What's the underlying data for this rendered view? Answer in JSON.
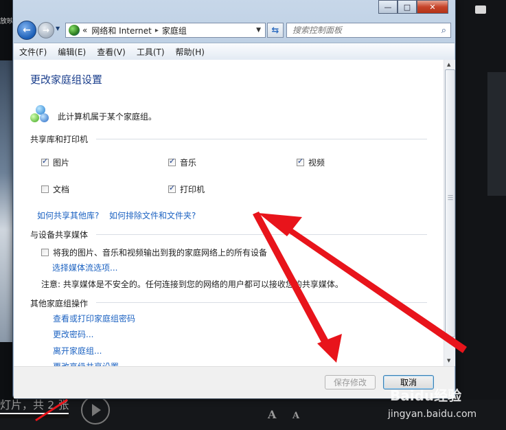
{
  "window": {
    "caption_buttons": {
      "minimize": "—",
      "maximize": "□",
      "close": "✕"
    }
  },
  "navigation": {
    "back_glyph": "←",
    "forward_glyph": "→",
    "address_prefix": "«",
    "breadcrumb": [
      "网络和 Internet",
      "家庭组"
    ],
    "separator": "▸",
    "refresh_glyph": "⇆",
    "search_placeholder": "搜索控制面板"
  },
  "menu": [
    "文件(F)",
    "编辑(E)",
    "查看(V)",
    "工具(T)",
    "帮助(H)"
  ],
  "content": {
    "title": "更改家庭组设置",
    "homegroup_status": "此计算机属于某个家庭组。",
    "libraries": {
      "heading": "共享库和打印机",
      "items": [
        {
          "label": "图片",
          "checked": true
        },
        {
          "label": "音乐",
          "checked": true
        },
        {
          "label": "视频",
          "checked": true
        },
        {
          "label": "文档",
          "checked": false
        },
        {
          "label": "打印机",
          "checked": true
        }
      ],
      "link_share_other": "如何共享其他库?",
      "link_exclude": "如何排除文件和文件夹?"
    },
    "media": {
      "heading": "与设备共享媒体",
      "stream_checkbox": {
        "label": "将我的图片、音乐和视频输出到我的家庭网络上的所有设备",
        "checked": false
      },
      "stream_options_link": "选择媒体流选项...",
      "note": "注意: 共享媒体是不安全的。任何连接到您的网络的用户都可以接收您的共享媒体。"
    },
    "other": {
      "heading": "其他家庭组操作",
      "links": [
        "查看或打印家庭组密码",
        "更改密码...",
        "离开家庭组...",
        "更改高级共享设置..."
      ]
    }
  },
  "buttons": {
    "save": "保存修改",
    "cancel": "取消"
  },
  "background": {
    "left_label": "放映",
    "caption": "灯片，共 2 张",
    "font_large": "A",
    "font_small": "A",
    "watermark": "Baidu经验",
    "watermark_url": "jingyan.baidu.com"
  },
  "colors": {
    "link": "#1d63c2",
    "title": "#1a3e8c",
    "arrow": "#e8141b"
  }
}
